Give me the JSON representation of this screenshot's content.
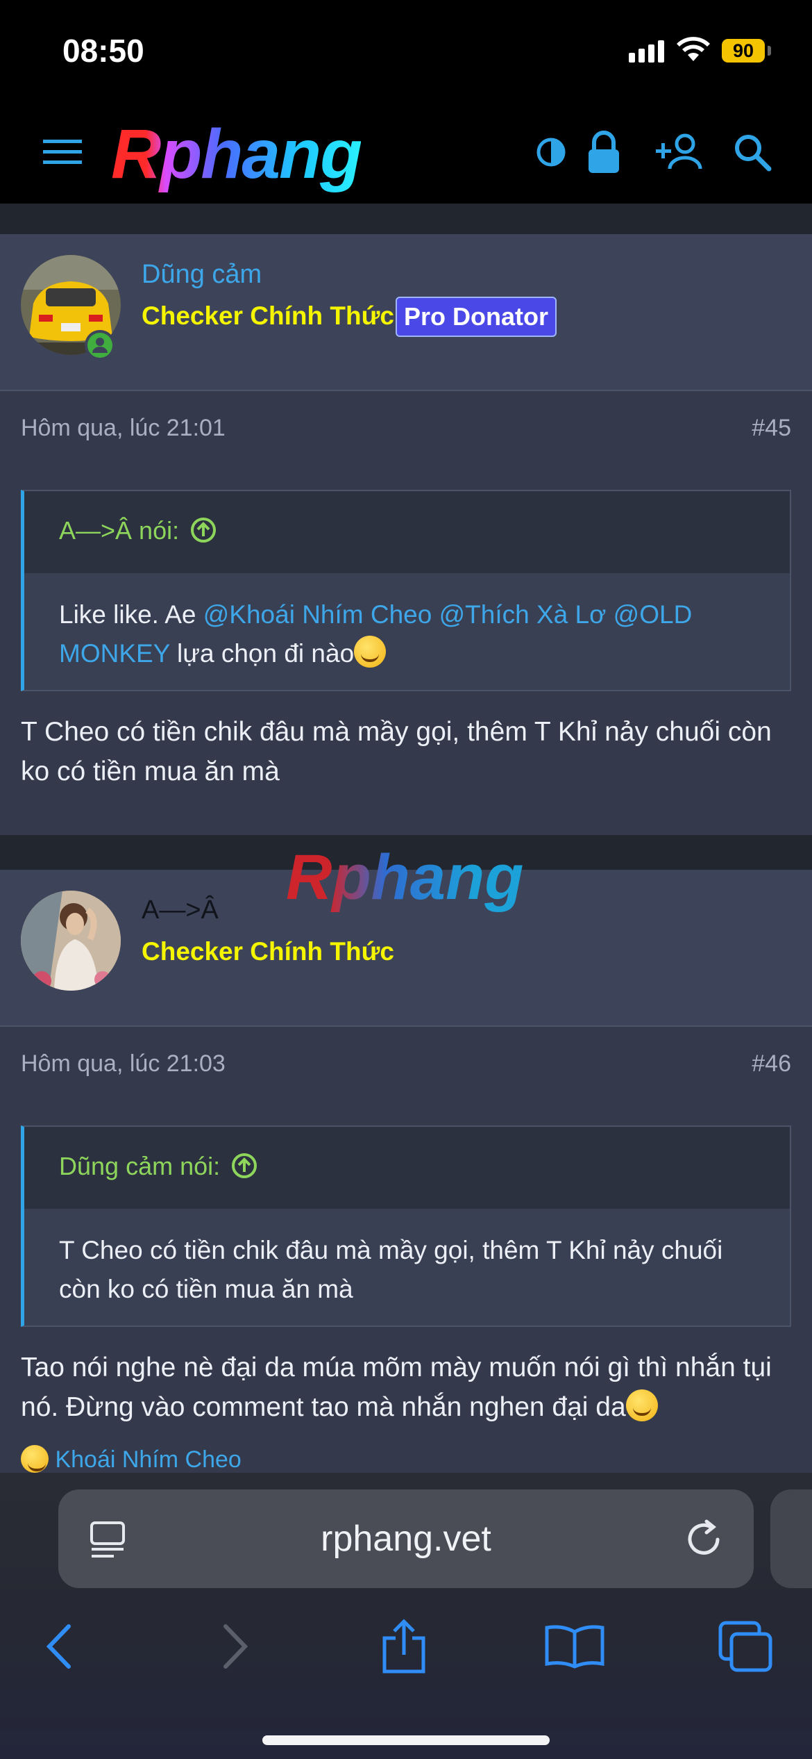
{
  "status_bar": {
    "time": "08:50",
    "battery": "90"
  },
  "header": {
    "logo_text": "Rphang"
  },
  "posts": [
    {
      "username": "Dũng cảm",
      "user_title": "Checker Chính Thức",
      "badge": "Pro Donator",
      "date": "Hôm qua, lúc 21:01",
      "number": "#45",
      "quote": {
        "author": "A—>Â nói:",
        "text_before": "Like like. Ae ",
        "mentions": [
          "@Khoái Nhím Cheo",
          "@Thích Xà Lơ",
          "@OLD MONKEY"
        ],
        "text_after": " lựa chọn đi nào"
      },
      "text": "T Cheo có tiền chik đâu mà mầy gọi, thêm T Khỉ nảy chuối còn ko có tiền mua ăn mà"
    },
    {
      "username": "A—>Â",
      "user_title": "Checker Chính Thức",
      "date": "Hôm qua, lúc 21:03",
      "number": "#46",
      "quote": {
        "author": "Dũng cảm nói:",
        "text": "T Cheo có tiền chik đâu mà mầy gọi, thêm T Khỉ nảy chuối còn ko có tiền mua ăn mà"
      },
      "text": "Tao nói nghe nè đại da múa mõm mày muốn nói gì thì nhắn tụi nó. Đừng vào comment tao mà nhắn nghen đại da",
      "reaction_user": "Khoái Nhím Cheo"
    }
  ],
  "watermark": "Rphang",
  "browser": {
    "url": "rphang.vet"
  },
  "colors": {
    "accent": "#3da7ea",
    "user_title": "#f5f500",
    "quote_author": "#8ed65b",
    "badge_bg": "#4a49e8"
  }
}
